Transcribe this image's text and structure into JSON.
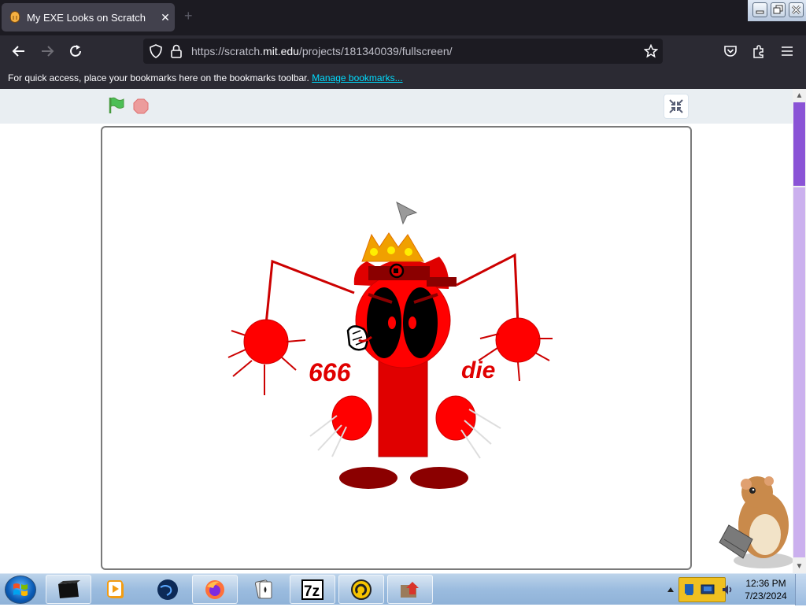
{
  "browser": {
    "tab": {
      "title": "My EXE Looks on Scratch",
      "close": "✕",
      "favicon": "scratch-cat-favicon"
    },
    "new_tab": "+",
    "url": {
      "prefix": "https://scratch.",
      "domain": "mit.edu",
      "suffix": "/projects/181340039/fullscreen/"
    },
    "bookmarks_toolbar": {
      "message": "For quick access, place your bookmarks here on the bookmarks toolbar.",
      "link": "Manage bookmarks..."
    }
  },
  "scratch": {
    "icons": [
      "green-flag-icon",
      "stop-icon",
      "exit-fullscreen-icon"
    ],
    "stage_text": {
      "left": "666",
      "right": "die"
    }
  },
  "taskbar": {
    "clock": {
      "time": "12:36 PM",
      "date": "7/23/2024"
    },
    "items": [
      "terminal",
      "media-player",
      "globe",
      "firefox",
      "solitaire",
      "7-zip",
      "lucky-patcher",
      "installer"
    ]
  },
  "colors": {
    "accent_red": "#ff0000",
    "dark_red": "#8b0000",
    "crown_orange": "#f0a000",
    "scrollbar": "#8a53d6"
  }
}
